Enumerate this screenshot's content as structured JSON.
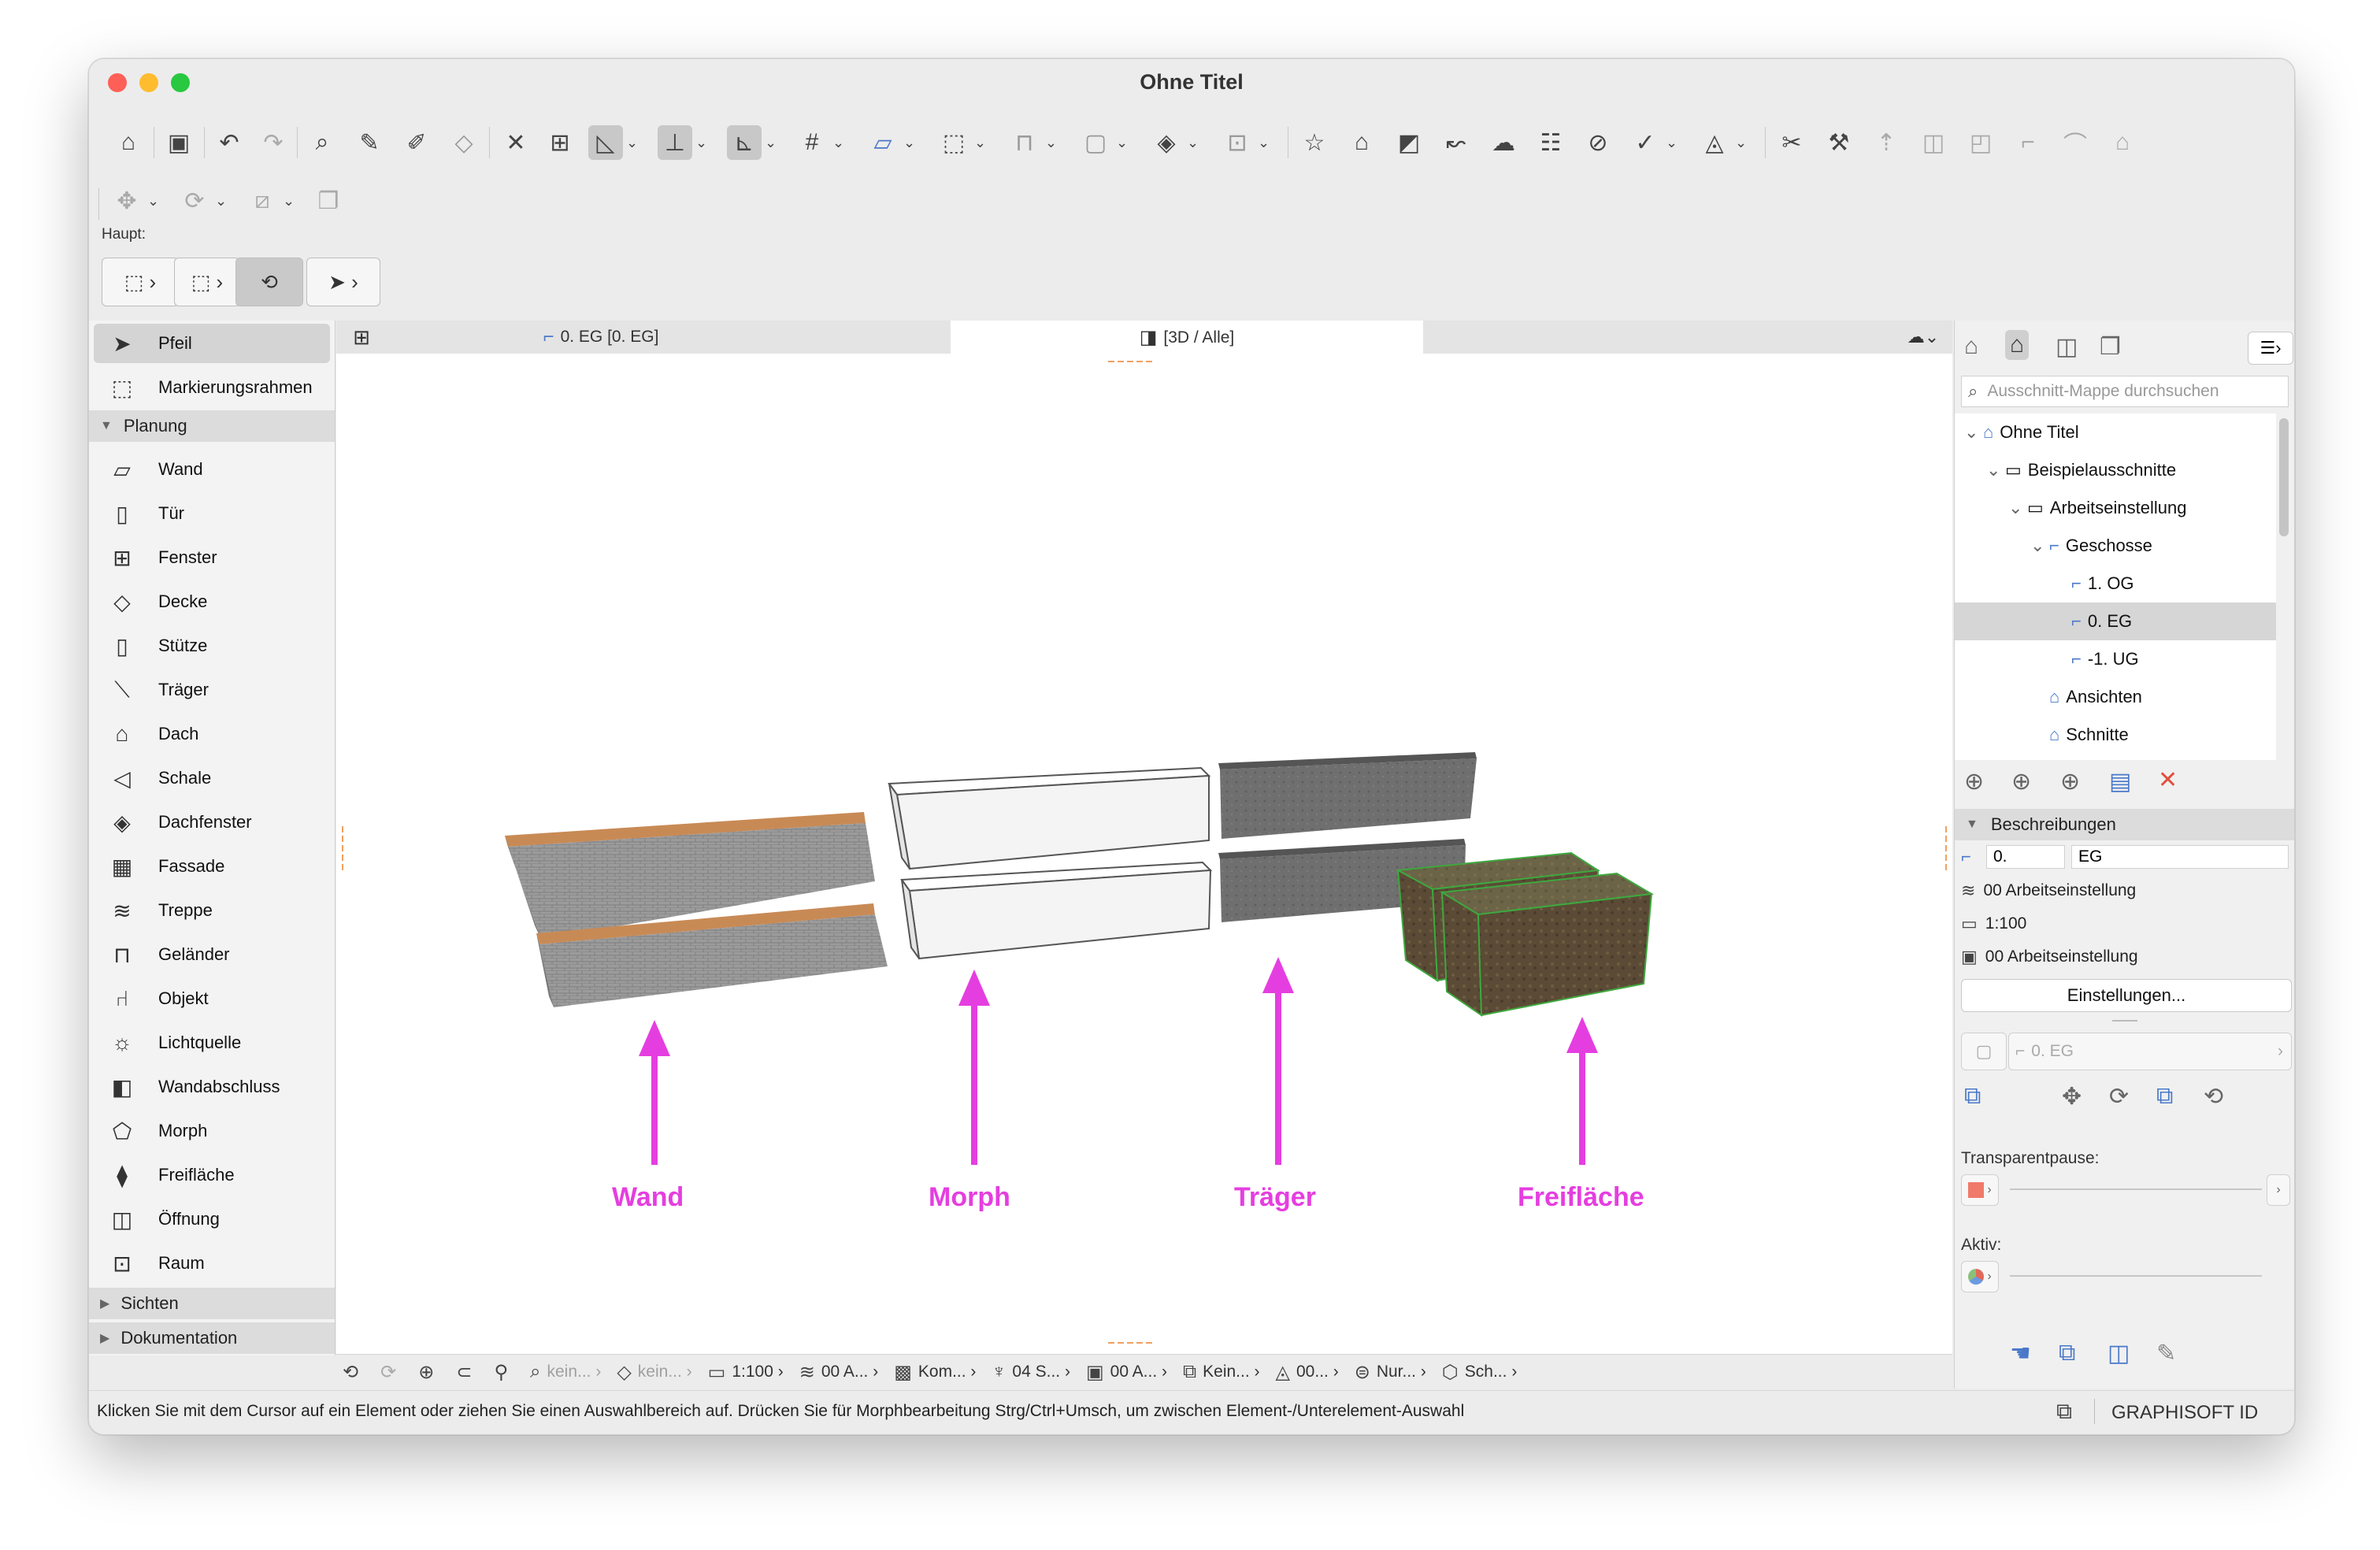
{
  "window": {
    "title": "Ohne Titel"
  },
  "toolbar": {
    "main_label": "Haupt:"
  },
  "left_tools": {
    "top": [
      {
        "label": "Pfeil",
        "icon": "arrow-pointer-icon",
        "active": true
      },
      {
        "label": "Markierungsrahmen",
        "icon": "marquee-icon"
      }
    ],
    "group_planung": "Planung",
    "planung": [
      {
        "label": "Wand",
        "icon": "wall-icon"
      },
      {
        "label": "Tür",
        "icon": "door-icon"
      },
      {
        "label": "Fenster",
        "icon": "window-icon"
      },
      {
        "label": "Decke",
        "icon": "slab-icon"
      },
      {
        "label": "Stütze",
        "icon": "column-icon"
      },
      {
        "label": "Träger",
        "icon": "beam-icon"
      },
      {
        "label": "Dach",
        "icon": "roof-icon"
      },
      {
        "label": "Schale",
        "icon": "shell-icon"
      },
      {
        "label": "Dachfenster",
        "icon": "skylight-icon"
      },
      {
        "label": "Fassade",
        "icon": "curtain-wall-icon"
      },
      {
        "label": "Treppe",
        "icon": "stair-icon"
      },
      {
        "label": "Geländer",
        "icon": "railing-icon"
      },
      {
        "label": "Objekt",
        "icon": "object-icon"
      },
      {
        "label": "Lichtquelle",
        "icon": "lamp-icon"
      },
      {
        "label": "Wandabschluss",
        "icon": "wall-end-icon"
      },
      {
        "label": "Morph",
        "icon": "morph-icon"
      },
      {
        "label": "Freifläche",
        "icon": "mesh-icon"
      },
      {
        "label": "Öffnung",
        "icon": "opening-icon"
      },
      {
        "label": "Raum",
        "icon": "zone-icon"
      }
    ],
    "group_sichten": "Sichten",
    "group_dokumentation": "Dokumentation"
  },
  "tabs": [
    {
      "label": "0. EG [0. EG]",
      "icon": "floorplan-icon"
    },
    {
      "label": "[3D / Alle]",
      "icon": "3d-view-icon",
      "active": true
    }
  ],
  "viewport_labels": [
    {
      "text": "Wand"
    },
    {
      "text": "Morph"
    },
    {
      "text": "Träger"
    },
    {
      "text": "Freifläche"
    }
  ],
  "bottom_bar": [
    {
      "text": "kein...",
      "dim": true
    },
    {
      "text": "kein...",
      "dim": true
    },
    {
      "text": "1:100"
    },
    {
      "text": "00 A..."
    },
    {
      "text": "Kom..."
    },
    {
      "text": "04 S..."
    },
    {
      "text": "00 A..."
    },
    {
      "text": "Kein..."
    },
    {
      "text": "00..."
    },
    {
      "text": "Nur..."
    },
    {
      "text": "Sch..."
    }
  ],
  "status": {
    "hint": "Klicken Sie mit dem Cursor auf ein Element oder ziehen Sie einen Auswahlbereich auf. Drücken Sie für Morphbearbeitung Strg/Ctrl+Umsch, um zwischen Element-/Unterelement-Auswahl",
    "brand": "GRAPHISOFT ID"
  },
  "navigator": {
    "search_placeholder": "Ausschnitt-Mappe durchsuchen",
    "tree": [
      {
        "label": "Ohne Titel",
        "level": 0,
        "icon": "project-icon",
        "expanded": true
      },
      {
        "label": "Beispielausschnitte",
        "level": 1,
        "icon": "folder-icon",
        "expanded": true
      },
      {
        "label": "Arbeitseinstellung",
        "level": 2,
        "icon": "folder-icon",
        "expanded": true
      },
      {
        "label": "Geschosse",
        "level": 3,
        "icon": "stories-icon",
        "expanded": true
      },
      {
        "label": "1. OG",
        "level": 4,
        "icon": "floorplan-icon"
      },
      {
        "label": "0. EG",
        "level": 4,
        "icon": "floorplan-icon",
        "selected": true
      },
      {
        "label": "-1. UG",
        "level": 4,
        "icon": "floorplan-icon"
      },
      {
        "label": "Ansichten",
        "level": 3,
        "icon": "elevation-icon"
      },
      {
        "label": "Schnitte",
        "level": 3,
        "icon": "section-icon"
      }
    ],
    "section_title": "Beschreibungen",
    "id_value": "0.",
    "name_value": "EG",
    "layer": "00 Arbeitseinstellung",
    "scale": "1:100",
    "pen_set": "00 Arbeitseinstellung",
    "settings_button": "Einstellungen...",
    "view_selector": "0. EG",
    "transparent_label": "Transparentpause:",
    "active_label": "Aktiv:"
  },
  "colors": {
    "accent_pink": "#e53ee0",
    "selected_gray": "#d4d4d4"
  }
}
